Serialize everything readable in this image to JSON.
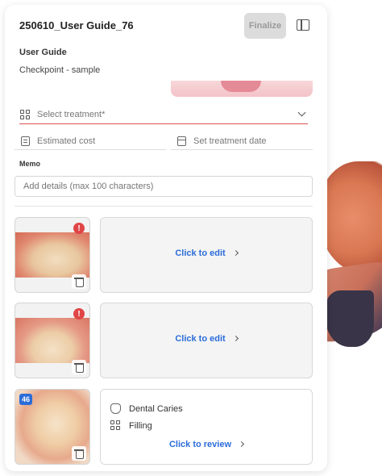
{
  "header": {
    "title": "250610_User Guide_76",
    "finalize_label": "Finalize"
  },
  "guide": {
    "title": "User Guide",
    "subtitle": "Checkpoint - sample"
  },
  "form": {
    "treatment_placeholder": "Select treatment*",
    "cost_placeholder": "Estimated cost",
    "date_placeholder": "Set treatment date",
    "memo_label": "Memo",
    "memo_placeholder": "Add details (max 100 characters)"
  },
  "items": [
    {
      "alert": "!",
      "action_label": "Click to edit"
    },
    {
      "alert": "!",
      "action_label": "Click to edit"
    },
    {
      "tooth_number": "46",
      "diagnosis": "Dental Caries",
      "treatment": "Filling",
      "action_label": "Click to review"
    }
  ],
  "colors": {
    "accent": "#2b6cd9",
    "alert": "#e04545",
    "required_underline": "#d9534f"
  },
  "icons": [
    "panel-toggle-icon",
    "treatment-grid-icon",
    "chevron-down-icon",
    "document-icon",
    "calendar-icon",
    "alert-icon",
    "trash-icon",
    "chevron-right-icon",
    "tooth-icon"
  ]
}
